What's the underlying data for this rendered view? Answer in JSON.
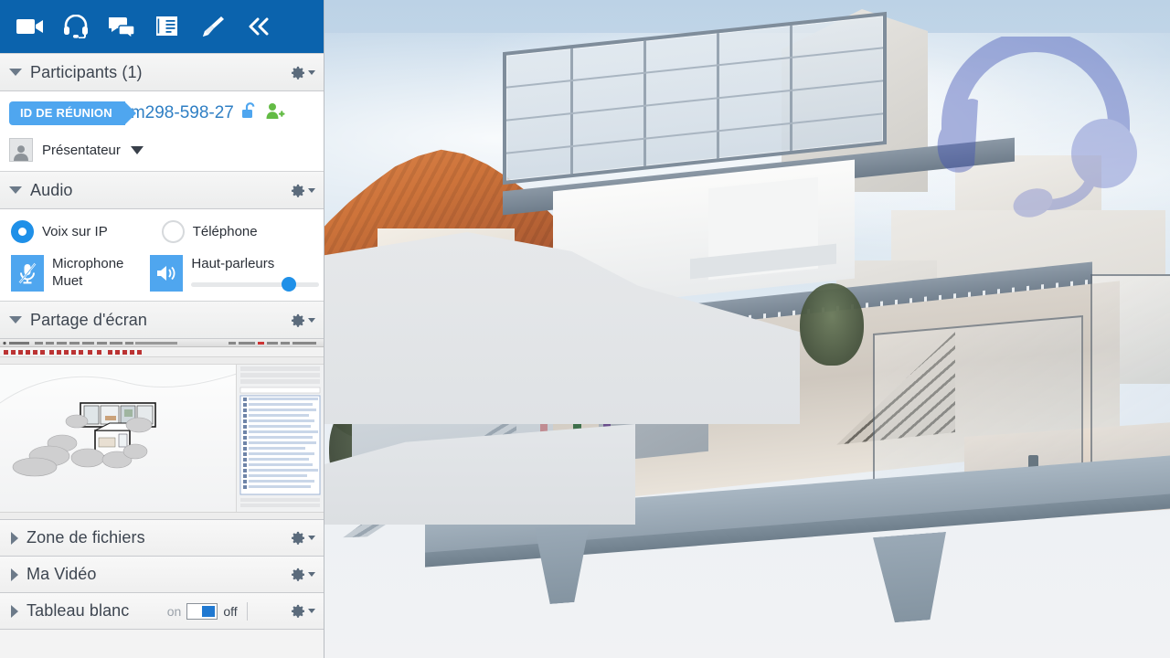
{
  "toolbar": {
    "buttons": [
      {
        "name": "video-camera-icon",
        "label": "Webcam"
      },
      {
        "name": "headset-icon",
        "label": "Audio"
      },
      {
        "name": "chat-bubbles-icon",
        "label": "Chat"
      },
      {
        "name": "documents-icon",
        "label": "Documents"
      },
      {
        "name": "paintbrush-icon",
        "label": "Annotation"
      },
      {
        "name": "collapse-chevrons-icon",
        "label": "«"
      }
    ],
    "background": "#0b63ad"
  },
  "panels": {
    "participants": {
      "title": "Participants (1)",
      "expanded": true,
      "meeting_id_label": "ID DE RÉUNION",
      "meeting_id_value": "m298-598-27",
      "lock_icon": "unlocked-padlock-icon",
      "add_user_icon": "add-participant-icon",
      "presenter": {
        "name": "Présentateur",
        "avatar": "person-avatar-icon",
        "caret": "chevron-down-icon"
      }
    },
    "audio": {
      "title": "Audio",
      "expanded": true,
      "options": [
        {
          "label": "Voix sur IP",
          "selected": true
        },
        {
          "label": "Téléphone",
          "selected": false
        }
      ],
      "microphone": {
        "line1": "Microphone",
        "line2": "Muet",
        "icon": "microphone-muted-icon",
        "muted": true
      },
      "speakers": {
        "label": "Haut-parleurs",
        "icon": "speaker-icon",
        "volume_percent": 71
      }
    },
    "screen_share": {
      "title": "Partage d'écran",
      "expanded": true,
      "preview": "sketchup-application-screenshot"
    },
    "file_zone": {
      "title": "Zone de fichiers",
      "expanded": false
    },
    "my_video": {
      "title": "Ma Vidéo",
      "expanded": false
    },
    "whiteboard": {
      "title": "Tableau blanc",
      "expanded": false,
      "toggle_on_label": "on",
      "toggle_off_label": "off",
      "toggle_state": "off"
    }
  },
  "gear_icon": "gear-icon",
  "stage": {
    "content": "architectural-3d-rendering",
    "watermark": "headset-watermark-icon"
  },
  "colors": {
    "toolbar_blue": "#0b63ad",
    "accent_blue": "#4fa6ef",
    "radio_blue": "#1f90e8",
    "id_value_blue": "#2f7fc4",
    "green": "#63bb45",
    "panel_text": "#3d4550"
  }
}
